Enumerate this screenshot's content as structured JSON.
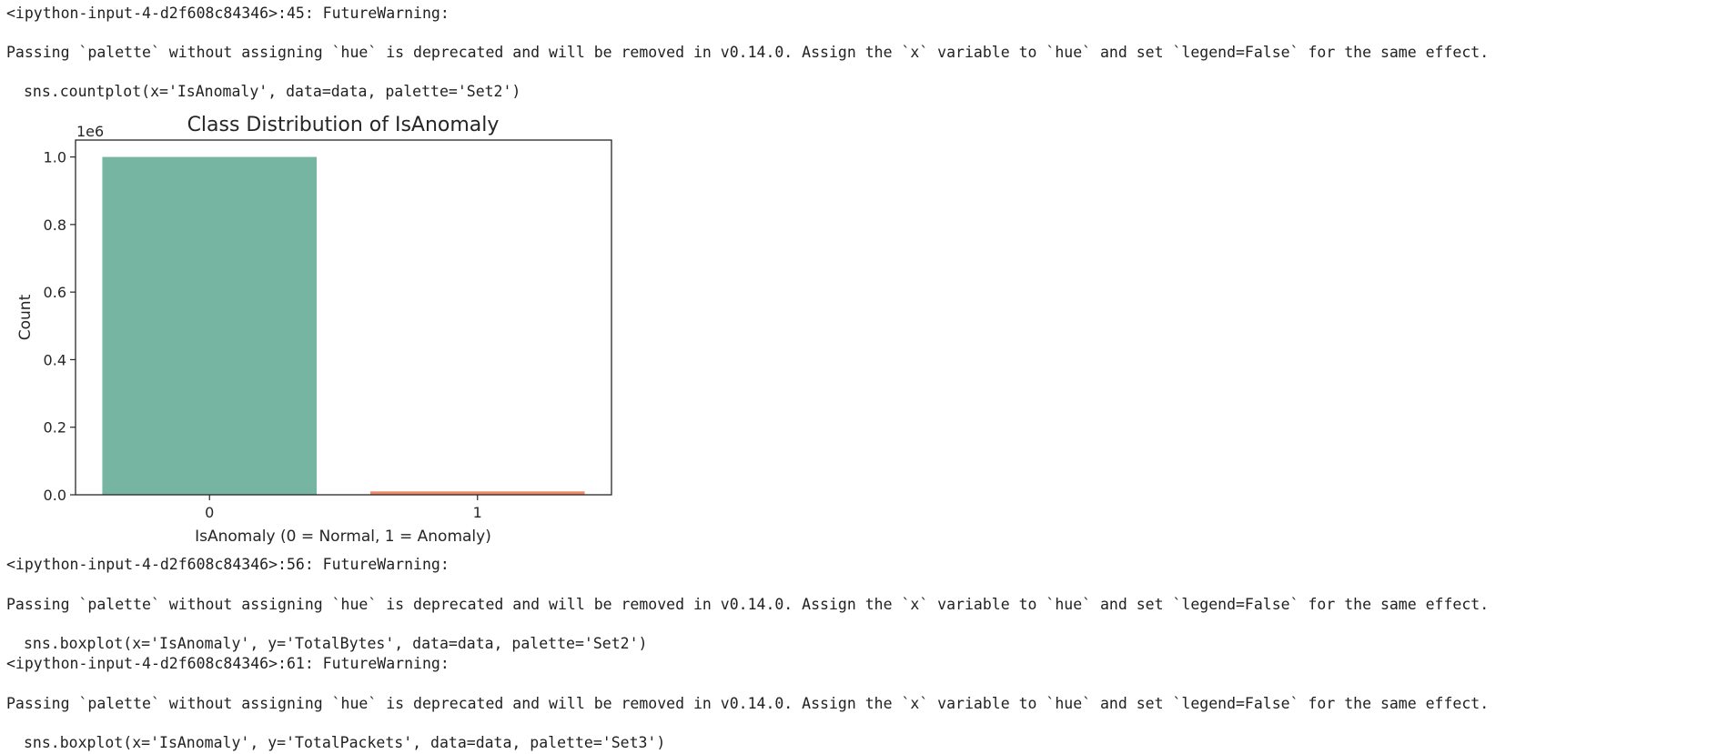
{
  "output": {
    "warning1_header": "<ipython-input-4-d2f608c84346>:45: FutureWarning:",
    "warning1_message": "Passing `palette` without assigning `hue` is deprecated and will be removed in v0.14.0. Assign the `x` variable to `hue` and set `legend=False` for the same effect.",
    "warning1_code": "sns.countplot(x='IsAnomaly', data=data, palette='Set2')",
    "warning2_header": "<ipython-input-4-d2f608c84346>:56: FutureWarning:",
    "warning2_message": "Passing `palette` without assigning `hue` is deprecated and will be removed in v0.14.0. Assign the `x` variable to `hue` and set `legend=False` for the same effect.",
    "warning2_code": "sns.boxplot(x='IsAnomaly', y='TotalBytes', data=data, palette='Set2')",
    "warning3_header": "<ipython-input-4-d2f608c84346>:61: FutureWarning:",
    "warning3_message": "Passing `palette` without assigning `hue` is deprecated and will be removed in v0.14.0. Assign the `x` variable to `hue` and set `legend=False` for the same effect.",
    "warning3_code": "sns.boxplot(x='IsAnomaly', y='TotalPackets', data=data, palette='Set3')"
  },
  "chart_data": {
    "type": "bar",
    "title": "Class Distribution of IsAnomaly",
    "xlabel": "IsAnomaly (0 = Normal, 1 = Anomaly)",
    "ylabel": "Count",
    "offset_label": "1e6",
    "categories": [
      "0",
      "1"
    ],
    "values": [
      1000000,
      10000
    ],
    "colors": [
      "#75b5a1",
      "#ee8a66"
    ],
    "ylim": [
      0,
      1.05
    ],
    "yticks": [
      "0.0",
      "0.2",
      "0.4",
      "0.6",
      "0.8",
      "1.0"
    ],
    "grid": false
  }
}
